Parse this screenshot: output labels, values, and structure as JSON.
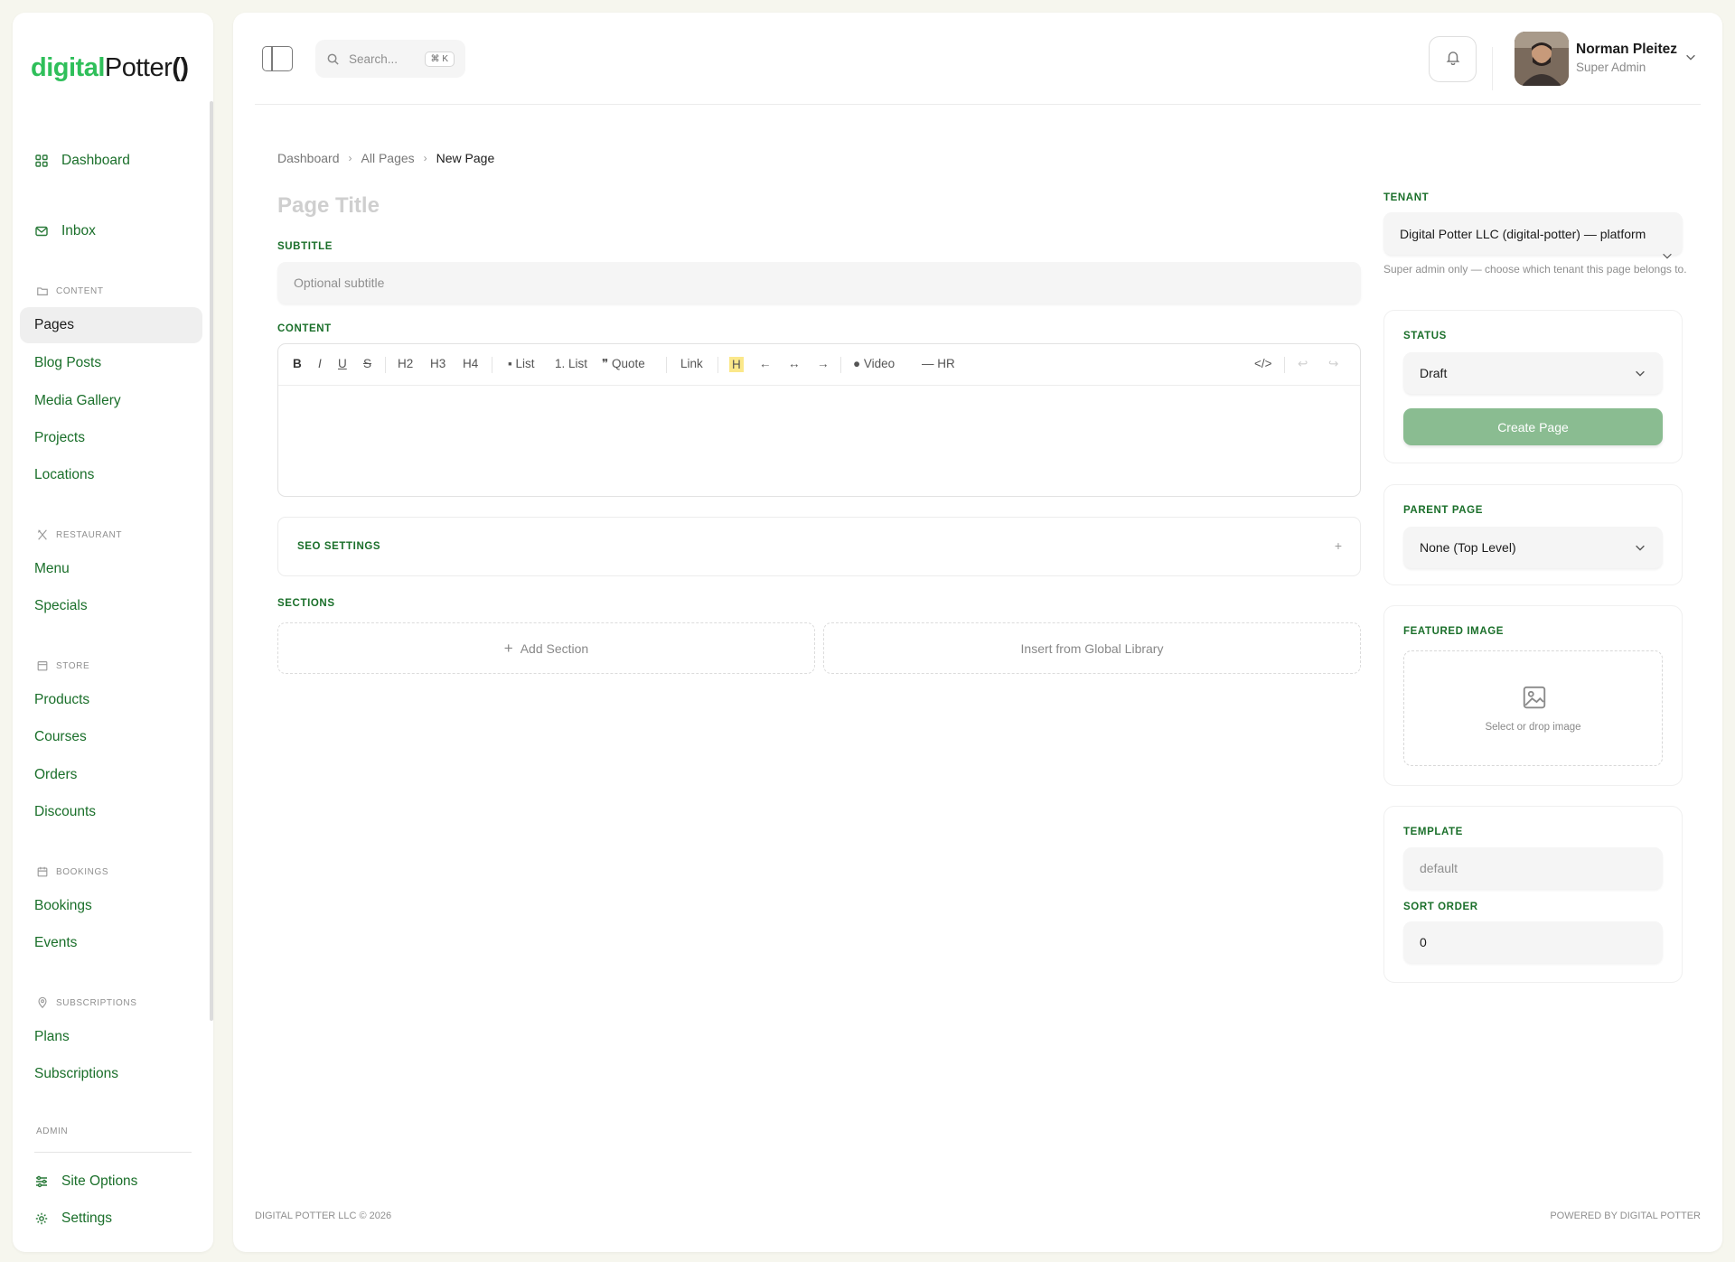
{
  "logo": {
    "part1": "digital",
    "part2": "Potter",
    "part3": "()"
  },
  "sidebar": {
    "dashboard": "Dashboard",
    "inbox": "Inbox",
    "sections": {
      "content": "CONTENT",
      "restaurant": "RESTAURANT",
      "store": "STORE",
      "bookings": "BOOKINGS",
      "subscriptions": "SUBSCRIPTIONS",
      "admin": "ADMIN"
    },
    "content_items": [
      "Pages",
      "Blog Posts",
      "Media Gallery",
      "Projects",
      "Locations"
    ],
    "restaurant_items": [
      "Menu",
      "Specials"
    ],
    "store_items": [
      "Products",
      "Courses",
      "Orders",
      "Discounts"
    ],
    "bookings_items": [
      "Bookings",
      "Events"
    ],
    "subscriptions_items": [
      "Plans",
      "Subscriptions"
    ],
    "admin_items": [
      "Site Options",
      "Settings"
    ]
  },
  "topbar": {
    "search_placeholder": "Search...",
    "search_shortcut": "⌘ K",
    "user_name": "Norman Pleitez",
    "user_role": "Super Admin"
  },
  "breadcrumbs": [
    "Dashboard",
    "All Pages",
    "New Page"
  ],
  "form": {
    "title_placeholder": "Page Title",
    "subtitle_label": "SUBTITLE",
    "subtitle_placeholder": "Optional subtitle",
    "content_label": "CONTENT",
    "toolbar": {
      "bold": "B",
      "italic": "I",
      "underline": "U",
      "strike": "S",
      "h2": "H2",
      "h3": "H3",
      "h4": "H4",
      "list": "List",
      "olist": "1. List",
      "quote": "Quote",
      "link": "Link",
      "highlight": "H",
      "align_left": "←",
      "align_center": "↔",
      "align_right": "→",
      "video": "Video",
      "hr": "— HR",
      "code": "</>",
      "undo": "↩",
      "redo": "↪"
    },
    "seo_label": "SEO SETTINGS",
    "seo_toggle": "+",
    "sections_label": "SECTIONS",
    "add_section": "Add Section",
    "insert_library": "Insert from Global Library"
  },
  "sidepanel": {
    "tenant_label": "TENANT",
    "tenant_value": "Digital Potter LLC (digital-potter) — platform",
    "tenant_help": "Super admin only — choose which tenant this page belongs to.",
    "status_label": "STATUS",
    "status_value": "Draft",
    "create_button": "Create Page",
    "parent_label": "PARENT PAGE",
    "parent_value": "None (Top Level)",
    "featured_label": "FEATURED IMAGE",
    "featured_hint": "Select or drop image",
    "template_label": "TEMPLATE",
    "template_placeholder": "default",
    "sort_label": "SORT ORDER",
    "sort_value": "0"
  },
  "footer": {
    "left": "DIGITAL POTTER LLC © 2026",
    "right": "POWERED BY DIGITAL POTTER"
  }
}
